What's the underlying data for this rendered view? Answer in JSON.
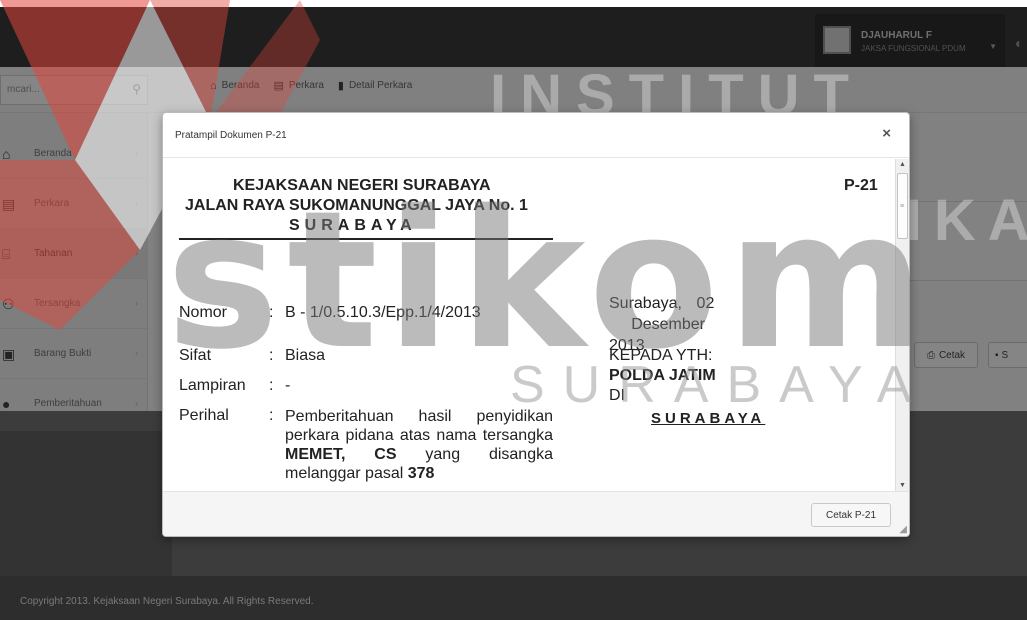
{
  "user": {
    "name": "DJAUHARUL F",
    "role": "JAKSA FUNGSIONAL PDUM"
  },
  "search": {
    "placeholder": "mcari..."
  },
  "breadcrumb": [
    {
      "icon": "home-icon",
      "label": "Beranda"
    },
    {
      "icon": "document-icon",
      "label": "Perkara"
    },
    {
      "icon": "file-icon",
      "label": "Detail Perkara"
    }
  ],
  "sidebar": {
    "items": [
      {
        "label": "Beranda"
      },
      {
        "label": "Perkara"
      },
      {
        "label": "Tahanan"
      },
      {
        "label": "Tersangka"
      },
      {
        "label": "Barang Bukti"
      },
      {
        "label": "Pemberitahuan"
      }
    ]
  },
  "background_buttons": {
    "cetak": "Cetak",
    "simpan": "S"
  },
  "footer": {
    "copyright": "Copyright 2013. Kejaksaan Negeri Surabaya. All Rights Reserved."
  },
  "watermark": {
    "line1": "INSTITUT BISNIS",
    "line2": "& INFORMATIKA",
    "logo_text": "stikom",
    "city": "SURABAYA"
  },
  "modal": {
    "title": "Pratampil Dokumen P-21",
    "close": "×",
    "doc": {
      "header_line1": "KEJAKSAAN NEGERI SURABAYA",
      "header_line2": "JALAN RAYA SUKOMANUNGGAL JAYA No. 1",
      "header_line3": "SURABAYA",
      "code": "P-21",
      "nomor_label": "Nomor",
      "nomor_value": "B - 1/0.5.10.3/Epp.1/4/2013",
      "sifat_label": "Sifat",
      "sifat_value": "Biasa",
      "lampiran_label": "Lampiran",
      "lampiran_value": "-",
      "perihal_label": "Perihal",
      "perihal_text1": "Pemberitahuan hasil penyidikan perkara pidana atas nama tersangka",
      "perihal_name": "MEMET, CS",
      "perihal_text2": "yang disangka melanggar pasal",
      "perihal_pasal": "378",
      "colon": ":",
      "date_city": "Surabaya,",
      "date_day": "02",
      "date_month": "Desember",
      "date_year": "2013",
      "kepada": "KEPADA YTH:",
      "recipient": "POLDA JATIM",
      "di": "DI",
      "recipient_city": "SURABAYA"
    },
    "print_button": "Cetak P-21"
  }
}
